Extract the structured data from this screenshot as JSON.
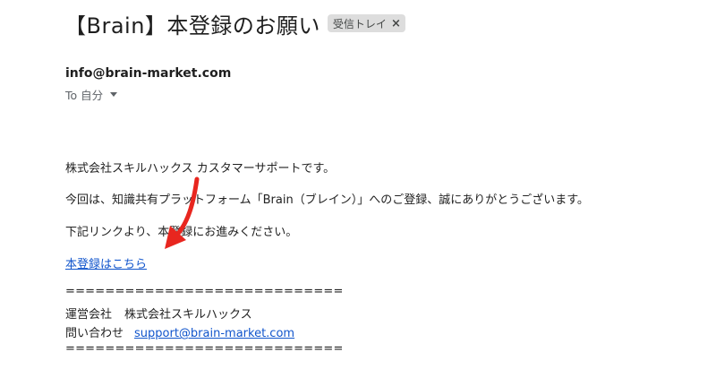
{
  "email": {
    "subject": "【Brain】本登録のお願い",
    "label_chip": "受信トレイ",
    "label_chip_close": "×",
    "sender": "info@brain-market.com",
    "recipient": "To 自分",
    "body": {
      "line1": "株式会社スキルハックス カスタマーサポートです。",
      "line2": "今回は、知識共有プラットフォーム「Brain（ブレイン）」へのご登録、誠にありがとうございます。",
      "line3": "下記リンクより、本登録にお進みください。",
      "link_text": "本登録はこちら",
      "separator_top": "============================",
      "company_label": "運営会社",
      "company_name": "株式会社スキルハックス",
      "contact_label": "問い合わせ",
      "contact_email": "support@brain-market.com",
      "separator_bottom": "============================"
    }
  },
  "colors": {
    "link": "#1155cc",
    "arrow": "#e8261f",
    "chip_bg": "#dddddd"
  },
  "icons": {
    "recipient_caret": "caret-down-icon",
    "annotation": "red-arrow-icon"
  }
}
